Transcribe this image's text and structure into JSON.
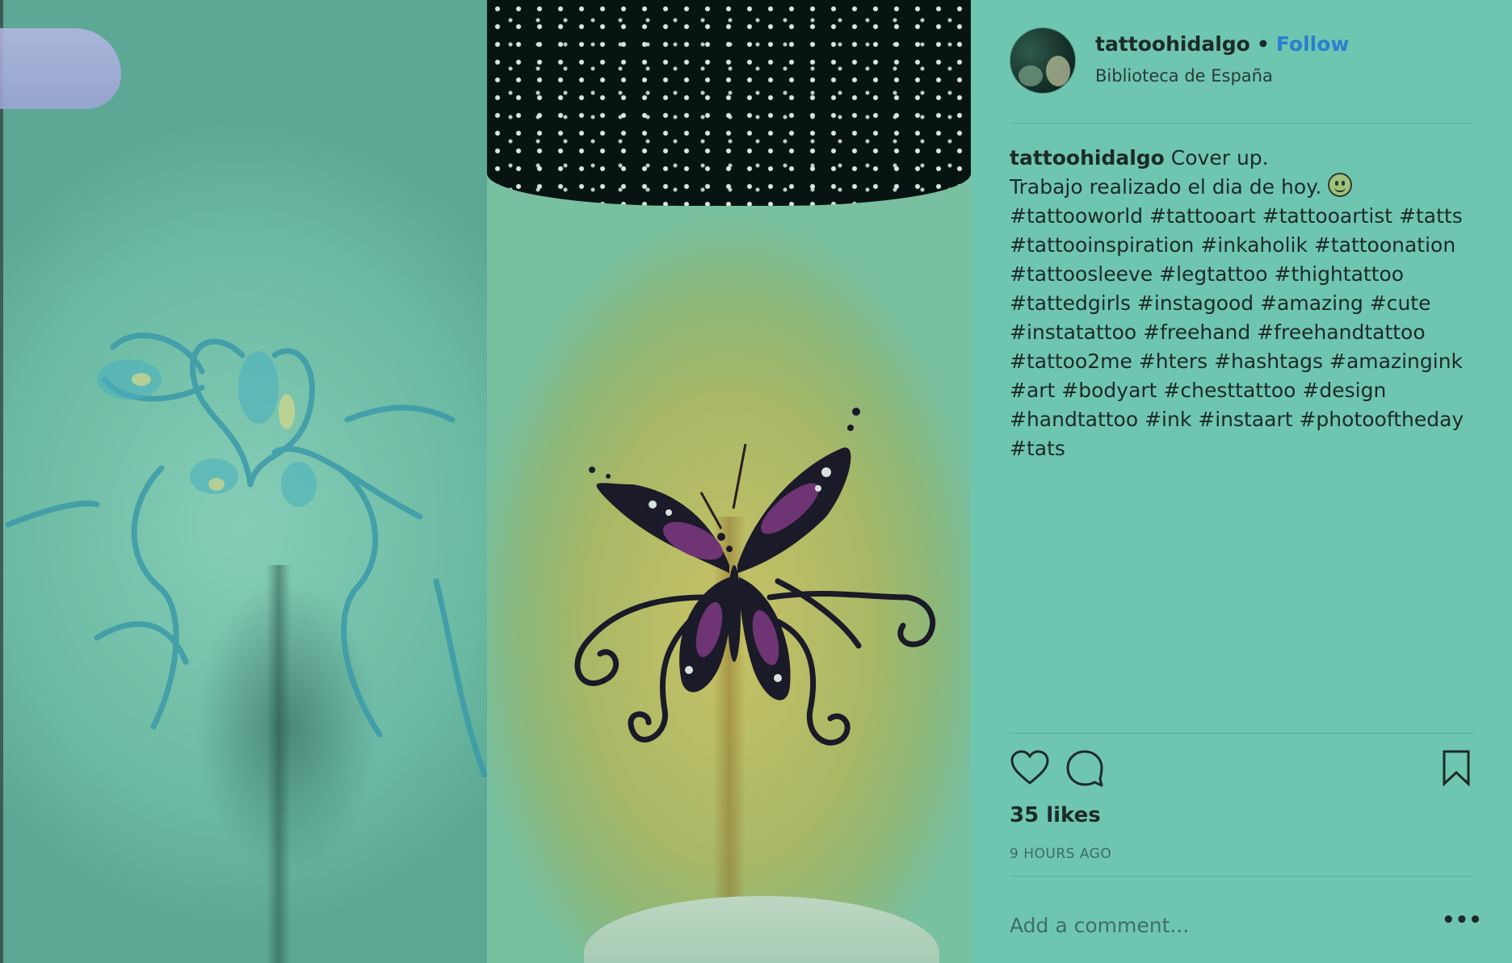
{
  "post": {
    "username": "tattoohidalgo",
    "separator": "•",
    "follow_label": "Follow",
    "location": "Biblioteca de España",
    "caption": {
      "username": "tattoohidalgo",
      "line1": " Cover up.",
      "line2": "Trabajo realizado el dia de hoy. ",
      "emoji": "smiley-face-emoji",
      "hashtags": "#tattooworld #tattooart #tattooartist #tatts\n#tattooinspiration #inkaholik #tattoonation\n#tattoosleeve #legtattoo #thightattoo\n#tattedgirls #instagood #amazing #cute\n#instatattoo #freehand #freehandtattoo\n#tattoo2me #hters #hashtags #amazingink\n#art #bodyart #chesttattoo #design\n#handtattoo #ink #instaart #photooftheday\n#tats"
    },
    "likes": "35 likes",
    "timestamp": "9 HOURS AGO",
    "comment": {
      "placeholder": "Add a comment...",
      "value": ""
    },
    "more_label": "•••"
  },
  "icons": {
    "like": "heart-icon",
    "comment": "comment-bubble-icon",
    "save": "bookmark-icon"
  },
  "colors": {
    "background": "#6fc6b0",
    "follow": "#2a7fd0",
    "text": "#1d2a27"
  }
}
